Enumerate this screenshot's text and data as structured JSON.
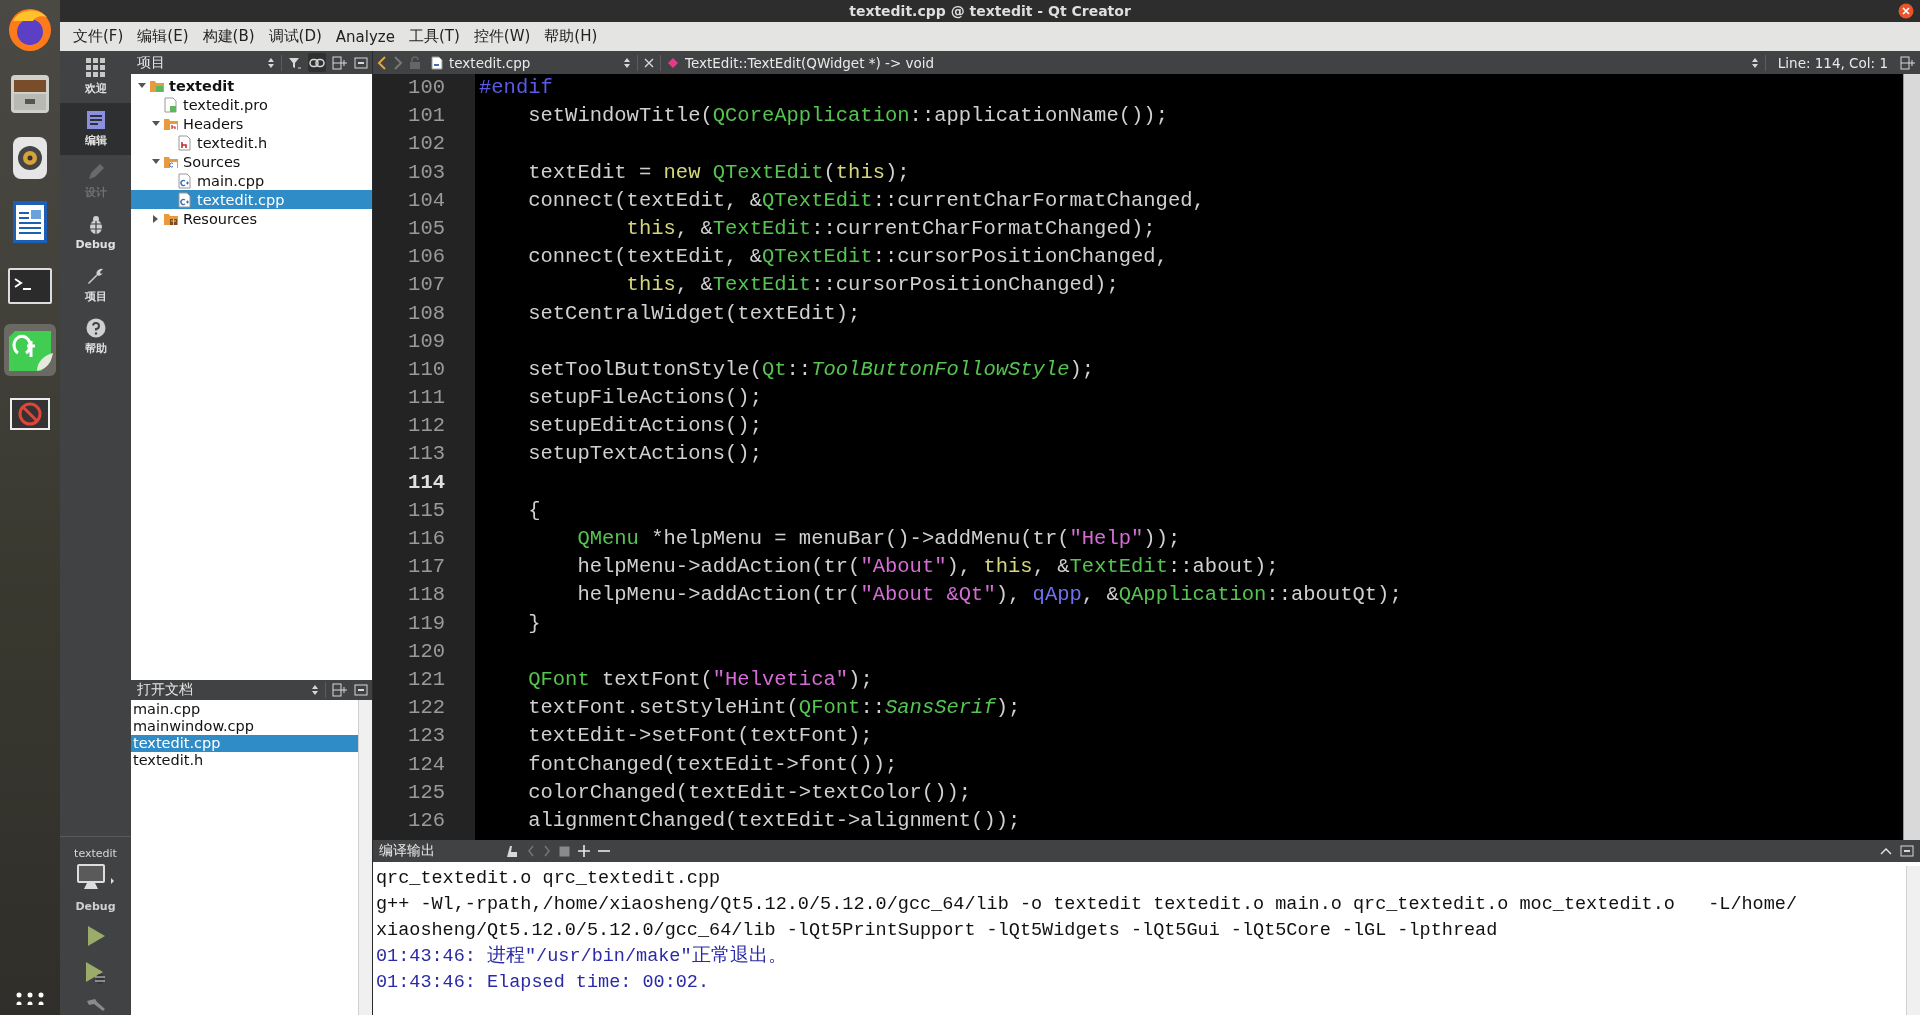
{
  "window": {
    "title": "textedit.cpp @ textedit - Qt Creator"
  },
  "dock": [
    {
      "kind": "browser",
      "selected": false
    },
    {
      "kind": "files",
      "selected": false
    },
    {
      "kind": "speaker",
      "selected": false
    },
    {
      "kind": "writer",
      "selected": false
    },
    {
      "kind": "terminal",
      "selected": false
    },
    {
      "kind": "qt",
      "selected": true
    },
    {
      "kind": "blocked",
      "selected": false
    }
  ],
  "menu": [
    "文件(F)",
    "编辑(E)",
    "构建(B)",
    "调试(D)",
    "Analyze",
    "工具(T)",
    "控件(W)",
    "帮助(H)"
  ],
  "mode_bar": {
    "modes": [
      {
        "label": "欢迎",
        "kind": "welcome",
        "selected": false,
        "disabled": false
      },
      {
        "label": "编辑",
        "kind": "edit",
        "selected": true,
        "disabled": false
      },
      {
        "label": "设计",
        "kind": "design",
        "selected": false,
        "disabled": true
      },
      {
        "label": "Debug",
        "kind": "debug",
        "selected": false,
        "disabled": false
      },
      {
        "label": "项目",
        "kind": "projects",
        "selected": false,
        "disabled": false
      },
      {
        "label": "帮助",
        "kind": "help",
        "selected": false,
        "disabled": false
      }
    ],
    "kit": {
      "project": "textedit",
      "configuration": "Debug"
    }
  },
  "project_pane": {
    "title": "项目",
    "tree": [
      {
        "label": "textedit",
        "kind": "project",
        "expanded": true,
        "selected": false,
        "children": [
          {
            "label": "textedit.pro",
            "kind": "pro",
            "selected": false
          },
          {
            "label": "Headers",
            "kind": "header-folder",
            "expanded": true,
            "selected": false,
            "children": [
              {
                "label": "textedit.h",
                "kind": "header",
                "selected": false
              }
            ]
          },
          {
            "label": "Sources",
            "kind": "source-folder",
            "expanded": true,
            "selected": false,
            "children": [
              {
                "label": "main.cpp",
                "kind": "source",
                "selected": false
              },
              {
                "label": "textedit.cpp",
                "kind": "source",
                "selected": true
              }
            ]
          },
          {
            "label": "Resources",
            "kind": "resource-folder",
            "expanded": false,
            "selected": false
          }
        ]
      }
    ]
  },
  "open_documents": {
    "title": "打开文档",
    "items": [
      {
        "label": "main.cpp",
        "selected": false
      },
      {
        "label": "mainwindow.cpp",
        "selected": false
      },
      {
        "label": "textedit.cpp",
        "selected": true
      },
      {
        "label": "textedit.h",
        "selected": false
      }
    ]
  },
  "editor": {
    "file": "textedit.cpp",
    "symbol": "TextEdit::TextEdit(QWidget *) -> void",
    "position": "Line: 114, Col: 1",
    "lines": [
      {
        "number": "100",
        "current": false,
        "tokens": [
          {
            "kind": "preproc",
            "text": "#endif"
          }
        ]
      },
      {
        "number": "101",
        "current": false,
        "tokens": [
          {
            "kind": "plain",
            "text": "    setWindowTitle("
          },
          {
            "kind": "type",
            "text": "QCoreApplication"
          },
          {
            "kind": "plain",
            "text": "::applicationName());"
          }
        ]
      },
      {
        "number": "102",
        "current": false
      },
      {
        "number": "103",
        "current": false,
        "tokens": [
          {
            "kind": "plain",
            "text": "    textEdit = "
          },
          {
            "kind": "keyword",
            "text": "new "
          },
          {
            "kind": "type",
            "text": "QTextEdit"
          },
          {
            "kind": "plain",
            "text": "("
          },
          {
            "kind": "keyword",
            "text": "this"
          },
          {
            "kind": "plain",
            "text": ");"
          }
        ]
      },
      {
        "number": "104",
        "current": false,
        "tokens": [
          {
            "kind": "plain",
            "text": "    connect(textEdit, &"
          },
          {
            "kind": "type",
            "text": "QTextEdit"
          },
          {
            "kind": "plain",
            "text": "::currentCharFormatChanged,"
          }
        ]
      },
      {
        "number": "105",
        "current": false,
        "tokens": [
          {
            "kind": "keyword",
            "text": "            this"
          },
          {
            "kind": "plain",
            "text": ", &"
          },
          {
            "kind": "type",
            "text": "TextEdit"
          },
          {
            "kind": "plain",
            "text": "::currentCharFormatChanged);"
          }
        ]
      },
      {
        "number": "106",
        "current": false,
        "tokens": [
          {
            "kind": "plain",
            "text": "    connect(textEdit, &"
          },
          {
            "kind": "type",
            "text": "QTextEdit"
          },
          {
            "kind": "plain",
            "text": "::cursorPositionChanged,"
          }
        ]
      },
      {
        "number": "107",
        "current": false,
        "tokens": [
          {
            "kind": "keyword",
            "text": "            this"
          },
          {
            "kind": "plain",
            "text": ", &"
          },
          {
            "kind": "type",
            "text": "TextEdit"
          },
          {
            "kind": "plain",
            "text": "::cursorPositionChanged);"
          }
        ]
      },
      {
        "number": "108",
        "current": false,
        "tokens": [
          {
            "kind": "plain",
            "text": "    setCentralWidget(textEdit);"
          }
        ]
      },
      {
        "number": "109",
        "current": false
      },
      {
        "number": "110",
        "current": false,
        "tokens": [
          {
            "kind": "plain",
            "text": "    setToolButtonStyle("
          },
          {
            "kind": "type",
            "text": "Qt"
          },
          {
            "kind": "plain",
            "text": "::"
          },
          {
            "kind": "enum",
            "text": "ToolButtonFollowStyle"
          },
          {
            "kind": "plain",
            "text": ");"
          }
        ]
      },
      {
        "number": "111",
        "current": false,
        "tokens": [
          {
            "kind": "plain",
            "text": "    setupFileActions();"
          }
        ]
      },
      {
        "number": "112",
        "current": false,
        "tokens": [
          {
            "kind": "plain",
            "text": "    setupEditActions();"
          }
        ]
      },
      {
        "number": "113",
        "current": false,
        "tokens": [
          {
            "kind": "plain",
            "text": "    setupTextActions();"
          }
        ]
      },
      {
        "number": "114",
        "current": true
      },
      {
        "number": "115",
        "current": false,
        "tokens": [
          {
            "kind": "plain",
            "text": "    {"
          }
        ]
      },
      {
        "number": "116",
        "current": false,
        "tokens": [
          {
            "kind": "type",
            "text": "        QMenu"
          },
          {
            "kind": "plain",
            "text": " *helpMenu = menuBar()->addMenu(tr("
          },
          {
            "kind": "string",
            "text": "\"Help\""
          },
          {
            "kind": "plain",
            "text": "));"
          }
        ]
      },
      {
        "number": "117",
        "current": false,
        "tokens": [
          {
            "kind": "plain",
            "text": "        helpMenu->addAction(tr("
          },
          {
            "kind": "string",
            "text": "\"About\""
          },
          {
            "kind": "plain",
            "text": "), "
          },
          {
            "kind": "keyword",
            "text": "this"
          },
          {
            "kind": "plain",
            "text": ", &"
          },
          {
            "kind": "type",
            "text": "TextEdit"
          },
          {
            "kind": "plain",
            "text": "::about);"
          }
        ]
      },
      {
        "number": "118",
        "current": false,
        "tokens": [
          {
            "kind": "plain",
            "text": "        helpMenu->addAction(tr("
          },
          {
            "kind": "string",
            "text": "\"About &Qt\""
          },
          {
            "kind": "plain",
            "text": "), "
          },
          {
            "kind": "global",
            "text": "qApp"
          },
          {
            "kind": "plain",
            "text": ", &"
          },
          {
            "kind": "type",
            "text": "QApplication"
          },
          {
            "kind": "plain",
            "text": "::aboutQt);"
          }
        ]
      },
      {
        "number": "119",
        "current": false,
        "tokens": [
          {
            "kind": "plain",
            "text": "    }"
          }
        ]
      },
      {
        "number": "120",
        "current": false
      },
      {
        "number": "121",
        "current": false,
        "tokens": [
          {
            "kind": "type",
            "text": "    QFont"
          },
          {
            "kind": "plain",
            "text": " textFont("
          },
          {
            "kind": "string",
            "text": "\"Helvetica\""
          },
          {
            "kind": "plain",
            "text": ");"
          }
        ]
      },
      {
        "number": "122",
        "current": false,
        "tokens": [
          {
            "kind": "plain",
            "text": "    textFont.setStyleHint("
          },
          {
            "kind": "type",
            "text": "QFont"
          },
          {
            "kind": "plain",
            "text": "::"
          },
          {
            "kind": "enum",
            "text": "SansSerif"
          },
          {
            "kind": "plain",
            "text": ");"
          }
        ]
      },
      {
        "number": "123",
        "current": false,
        "tokens": [
          {
            "kind": "plain",
            "text": "    textEdit->setFont(textFont);"
          }
        ]
      },
      {
        "number": "124",
        "current": false,
        "tokens": [
          {
            "kind": "plain",
            "text": "    fontChanged(textEdit->font());"
          }
        ]
      },
      {
        "number": "125",
        "current": false,
        "tokens": [
          {
            "kind": "plain",
            "text": "    colorChanged(textEdit->textColor());"
          }
        ]
      },
      {
        "number": "126",
        "current": false,
        "tokens": [
          {
            "kind": "plain",
            "text": "    alignmentChanged(textEdit->alignment());"
          }
        ]
      }
    ]
  },
  "output": {
    "title": "编译输出",
    "lines": [
      {
        "kind": "plain",
        "text": "qrc_textedit.o qrc_textedit.cpp"
      },
      {
        "kind": "plain",
        "text": "g++ -Wl,-rpath,/home/xiaosheng/Qt5.12.0/5.12.0/gcc_64/lib -o textedit textedit.o main.o qrc_textedit.o moc_textedit.o   -L/home/"
      },
      {
        "kind": "plain",
        "text": "xiaosheng/Qt5.12.0/5.12.0/gcc_64/lib -lQt5PrintSupport -lQt5Widgets -lQt5Gui -lQt5Core -lGL -lpthread"
      },
      {
        "kind": "info",
        "text": "01:43:46: 进程\"/usr/bin/make\"正常退出。"
      },
      {
        "kind": "info",
        "text": "01:43:46: Elapsed time: 00:02."
      }
    ]
  }
}
